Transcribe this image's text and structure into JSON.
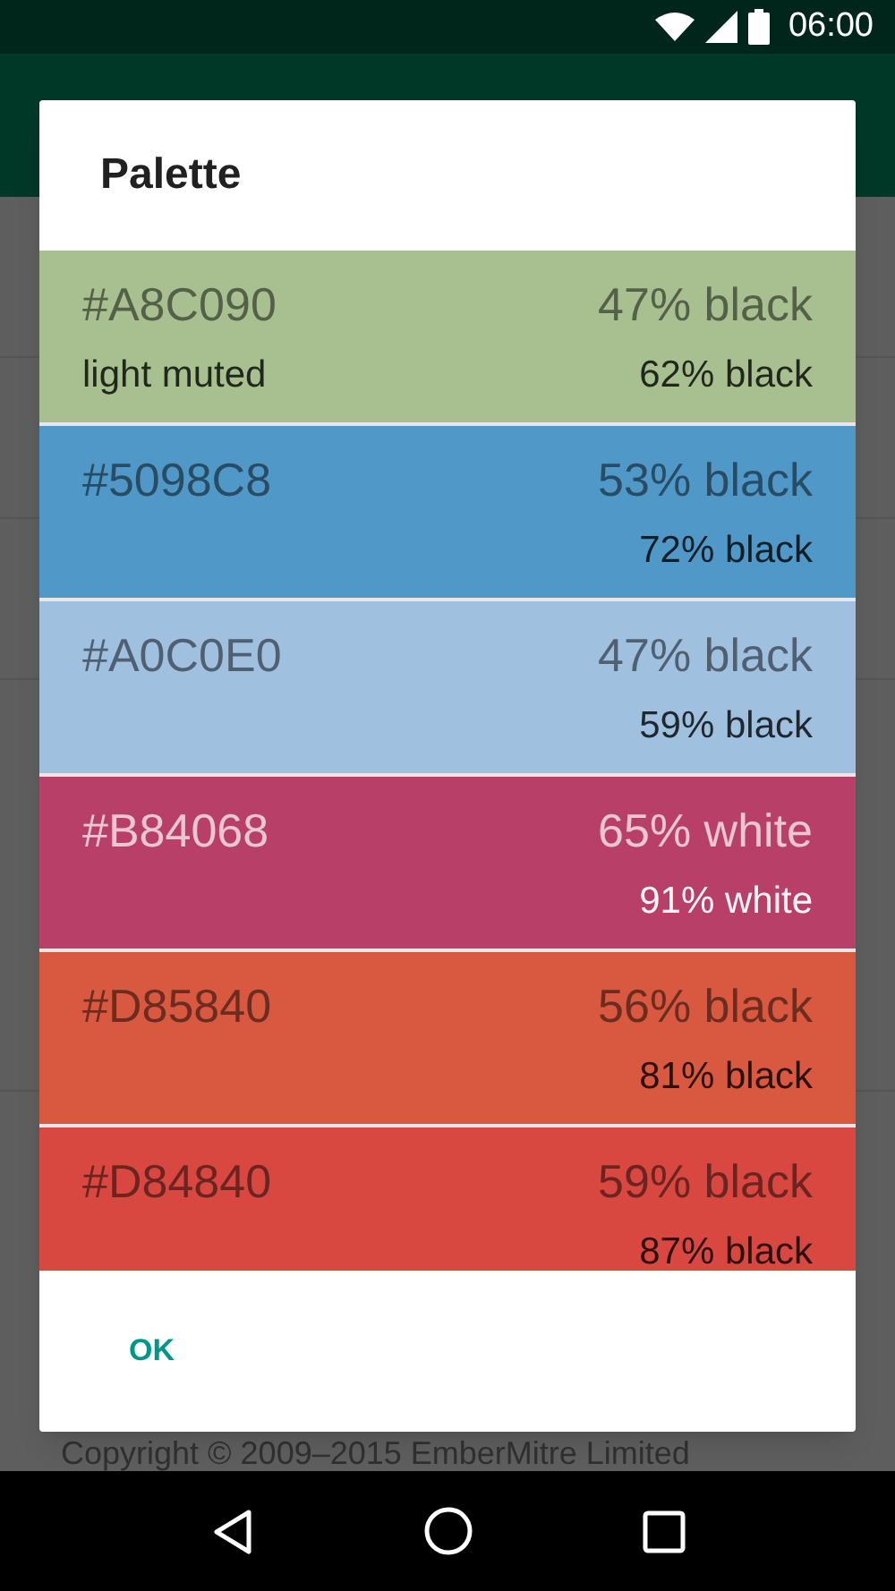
{
  "status_bar": {
    "time": "06:00"
  },
  "dialog": {
    "title": "Palette",
    "swatches": [
      {
        "color": "#a8c090",
        "hex": "#A8C090",
        "tag": "light muted",
        "title_text": "47% black",
        "body_text": "62% black",
        "kind": "dark"
      },
      {
        "color": "#5098c8",
        "hex": "#5098C8",
        "title_text": "53% black",
        "body_text": "72% black",
        "kind": "dark"
      },
      {
        "color": "#a0c0e0",
        "hex": "#A0C0E0",
        "title_text": "47% black",
        "body_text": "59% black",
        "kind": "dark"
      },
      {
        "color": "#b84068",
        "hex": "#B84068",
        "title_text": "65% white",
        "body_text": "91% white",
        "kind": "light"
      },
      {
        "color": "#d85840",
        "hex": "#D85840",
        "title_text": "56% black",
        "body_text": "81% black",
        "kind": "dark"
      },
      {
        "color": "#d84840",
        "hex": "#D84840",
        "title_text": "59% black",
        "body_text": "87% black",
        "kind": "dark"
      }
    ],
    "buttons": [
      "OK"
    ]
  },
  "footer": {
    "copyright": "Copyright © 2009–2015 EmberMitre Limited"
  }
}
